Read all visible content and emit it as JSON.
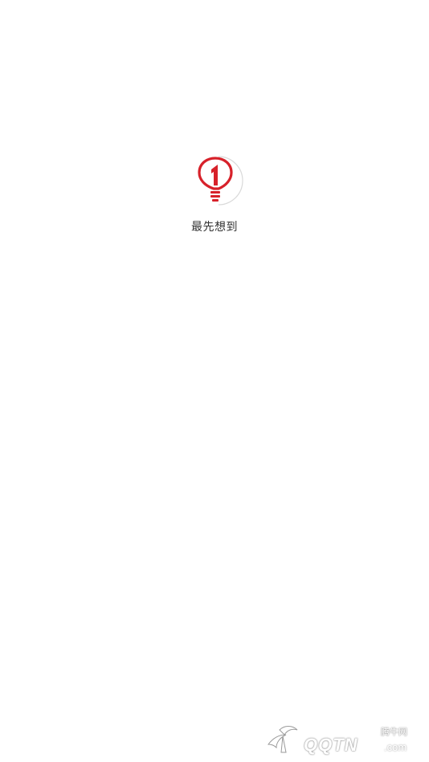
{
  "app": {
    "name": "最先想到",
    "logo_icon": "lightbulb-one-logo-icon",
    "accent_color": "#d7212a"
  },
  "watermark": {
    "cn_label": "腾牛网",
    "brand": "QQTN",
    "domain": ".com",
    "mark_icon": "bird-logo-icon"
  }
}
